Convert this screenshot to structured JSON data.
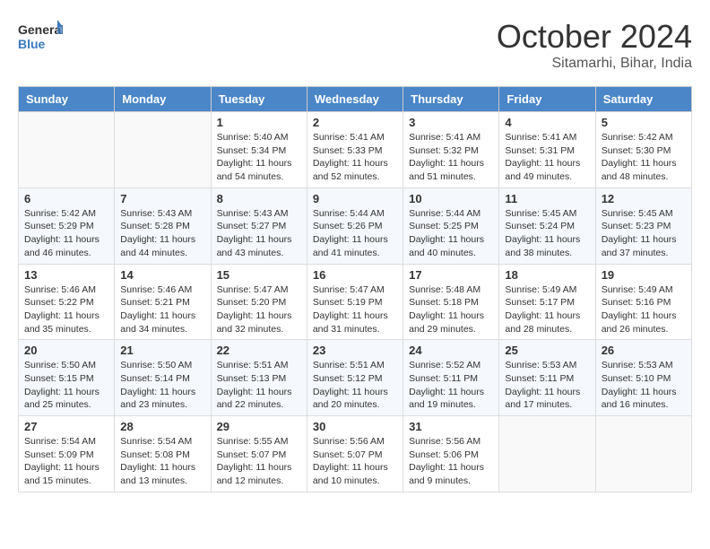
{
  "header": {
    "logo_general": "General",
    "logo_blue": "Blue",
    "month_title": "October 2024",
    "location": "Sitamarhi, Bihar, India"
  },
  "days_of_week": [
    "Sunday",
    "Monday",
    "Tuesday",
    "Wednesday",
    "Thursday",
    "Friday",
    "Saturday"
  ],
  "weeks": [
    [
      {
        "day": "",
        "sunrise": "",
        "sunset": "",
        "daylight": ""
      },
      {
        "day": "",
        "sunrise": "",
        "sunset": "",
        "daylight": ""
      },
      {
        "day": "1",
        "sunrise": "Sunrise: 5:40 AM",
        "sunset": "Sunset: 5:34 PM",
        "daylight": "Daylight: 11 hours and 54 minutes."
      },
      {
        "day": "2",
        "sunrise": "Sunrise: 5:41 AM",
        "sunset": "Sunset: 5:33 PM",
        "daylight": "Daylight: 11 hours and 52 minutes."
      },
      {
        "day": "3",
        "sunrise": "Sunrise: 5:41 AM",
        "sunset": "Sunset: 5:32 PM",
        "daylight": "Daylight: 11 hours and 51 minutes."
      },
      {
        "day": "4",
        "sunrise": "Sunrise: 5:41 AM",
        "sunset": "Sunset: 5:31 PM",
        "daylight": "Daylight: 11 hours and 49 minutes."
      },
      {
        "day": "5",
        "sunrise": "Sunrise: 5:42 AM",
        "sunset": "Sunset: 5:30 PM",
        "daylight": "Daylight: 11 hours and 48 minutes."
      }
    ],
    [
      {
        "day": "6",
        "sunrise": "Sunrise: 5:42 AM",
        "sunset": "Sunset: 5:29 PM",
        "daylight": "Daylight: 11 hours and 46 minutes."
      },
      {
        "day": "7",
        "sunrise": "Sunrise: 5:43 AM",
        "sunset": "Sunset: 5:28 PM",
        "daylight": "Daylight: 11 hours and 44 minutes."
      },
      {
        "day": "8",
        "sunrise": "Sunrise: 5:43 AM",
        "sunset": "Sunset: 5:27 PM",
        "daylight": "Daylight: 11 hours and 43 minutes."
      },
      {
        "day": "9",
        "sunrise": "Sunrise: 5:44 AM",
        "sunset": "Sunset: 5:26 PM",
        "daylight": "Daylight: 11 hours and 41 minutes."
      },
      {
        "day": "10",
        "sunrise": "Sunrise: 5:44 AM",
        "sunset": "Sunset: 5:25 PM",
        "daylight": "Daylight: 11 hours and 40 minutes."
      },
      {
        "day": "11",
        "sunrise": "Sunrise: 5:45 AM",
        "sunset": "Sunset: 5:24 PM",
        "daylight": "Daylight: 11 hours and 38 minutes."
      },
      {
        "day": "12",
        "sunrise": "Sunrise: 5:45 AM",
        "sunset": "Sunset: 5:23 PM",
        "daylight": "Daylight: 11 hours and 37 minutes."
      }
    ],
    [
      {
        "day": "13",
        "sunrise": "Sunrise: 5:46 AM",
        "sunset": "Sunset: 5:22 PM",
        "daylight": "Daylight: 11 hours and 35 minutes."
      },
      {
        "day": "14",
        "sunrise": "Sunrise: 5:46 AM",
        "sunset": "Sunset: 5:21 PM",
        "daylight": "Daylight: 11 hours and 34 minutes."
      },
      {
        "day": "15",
        "sunrise": "Sunrise: 5:47 AM",
        "sunset": "Sunset: 5:20 PM",
        "daylight": "Daylight: 11 hours and 32 minutes."
      },
      {
        "day": "16",
        "sunrise": "Sunrise: 5:47 AM",
        "sunset": "Sunset: 5:19 PM",
        "daylight": "Daylight: 11 hours and 31 minutes."
      },
      {
        "day": "17",
        "sunrise": "Sunrise: 5:48 AM",
        "sunset": "Sunset: 5:18 PM",
        "daylight": "Daylight: 11 hours and 29 minutes."
      },
      {
        "day": "18",
        "sunrise": "Sunrise: 5:49 AM",
        "sunset": "Sunset: 5:17 PM",
        "daylight": "Daylight: 11 hours and 28 minutes."
      },
      {
        "day": "19",
        "sunrise": "Sunrise: 5:49 AM",
        "sunset": "Sunset: 5:16 PM",
        "daylight": "Daylight: 11 hours and 26 minutes."
      }
    ],
    [
      {
        "day": "20",
        "sunrise": "Sunrise: 5:50 AM",
        "sunset": "Sunset: 5:15 PM",
        "daylight": "Daylight: 11 hours and 25 minutes."
      },
      {
        "day": "21",
        "sunrise": "Sunrise: 5:50 AM",
        "sunset": "Sunset: 5:14 PM",
        "daylight": "Daylight: 11 hours and 23 minutes."
      },
      {
        "day": "22",
        "sunrise": "Sunrise: 5:51 AM",
        "sunset": "Sunset: 5:13 PM",
        "daylight": "Daylight: 11 hours and 22 minutes."
      },
      {
        "day": "23",
        "sunrise": "Sunrise: 5:51 AM",
        "sunset": "Sunset: 5:12 PM",
        "daylight": "Daylight: 11 hours and 20 minutes."
      },
      {
        "day": "24",
        "sunrise": "Sunrise: 5:52 AM",
        "sunset": "Sunset: 5:11 PM",
        "daylight": "Daylight: 11 hours and 19 minutes."
      },
      {
        "day": "25",
        "sunrise": "Sunrise: 5:53 AM",
        "sunset": "Sunset: 5:11 PM",
        "daylight": "Daylight: 11 hours and 17 minutes."
      },
      {
        "day": "26",
        "sunrise": "Sunrise: 5:53 AM",
        "sunset": "Sunset: 5:10 PM",
        "daylight": "Daylight: 11 hours and 16 minutes."
      }
    ],
    [
      {
        "day": "27",
        "sunrise": "Sunrise: 5:54 AM",
        "sunset": "Sunset: 5:09 PM",
        "daylight": "Daylight: 11 hours and 15 minutes."
      },
      {
        "day": "28",
        "sunrise": "Sunrise: 5:54 AM",
        "sunset": "Sunset: 5:08 PM",
        "daylight": "Daylight: 11 hours and 13 minutes."
      },
      {
        "day": "29",
        "sunrise": "Sunrise: 5:55 AM",
        "sunset": "Sunset: 5:07 PM",
        "daylight": "Daylight: 11 hours and 12 minutes."
      },
      {
        "day": "30",
        "sunrise": "Sunrise: 5:56 AM",
        "sunset": "Sunset: 5:07 PM",
        "daylight": "Daylight: 11 hours and 10 minutes."
      },
      {
        "day": "31",
        "sunrise": "Sunrise: 5:56 AM",
        "sunset": "Sunset: 5:06 PM",
        "daylight": "Daylight: 11 hours and 9 minutes."
      },
      {
        "day": "",
        "sunrise": "",
        "sunset": "",
        "daylight": ""
      },
      {
        "day": "",
        "sunrise": "",
        "sunset": "",
        "daylight": ""
      }
    ]
  ]
}
